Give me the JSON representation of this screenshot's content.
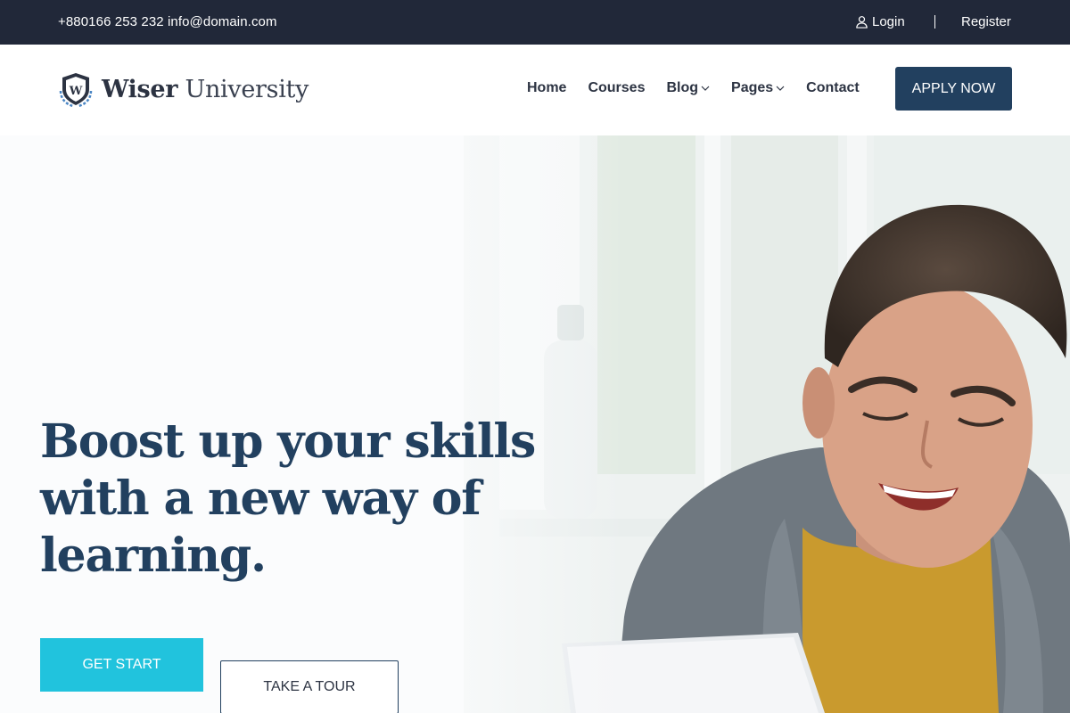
{
  "topbar": {
    "contact": "+880166 253 232 info@domain.com",
    "login": "Login",
    "register": "Register"
  },
  "header": {
    "logo": {
      "bold": "Wiser",
      "light": "University",
      "emblem_letter": "W"
    },
    "nav": {
      "home": "Home",
      "courses": "Courses",
      "blog": "Blog",
      "pages": "Pages",
      "contact": "Contact"
    },
    "apply_label": "APPLY NOW"
  },
  "hero": {
    "headline": [
      "Boost up your skills",
      "with a new way of",
      "learning."
    ],
    "primary_button": "GET START",
    "secondary_button": "TAKE A TOUR"
  },
  "colors": {
    "topbar_bg": "#212839",
    "brand_navy": "#22405f",
    "accent_cyan": "#21c3dd"
  },
  "icons": [
    "user-icon",
    "chevron-down-icon",
    "shield-icon"
  ]
}
